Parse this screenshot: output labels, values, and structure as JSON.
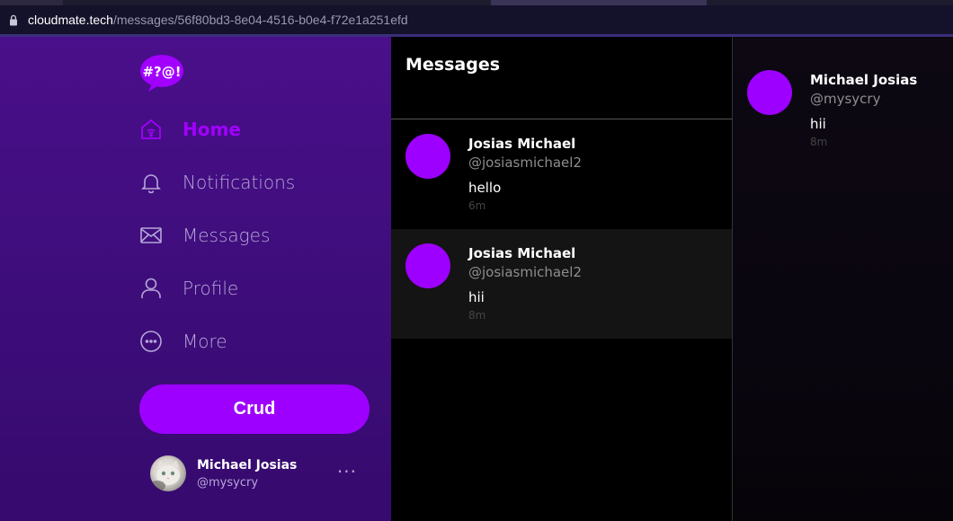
{
  "browser": {
    "url_domain": "cloudmate.tech",
    "url_path": "/messages/56f80bd3-8e04-4516-b0e4-f72e1a251efd"
  },
  "colors": {
    "accent": "#9d00ff",
    "sidebar_bg": "#3d0d7a"
  },
  "sidebar": {
    "logo_icon": "chat-bubble-logo-icon",
    "nav": [
      {
        "label": "Home",
        "icon": "home-icon",
        "active": true
      },
      {
        "label": "Notifications",
        "icon": "bell-icon",
        "active": false
      },
      {
        "label": "Messages",
        "icon": "envelope-icon",
        "active": false
      },
      {
        "label": "Profile",
        "icon": "user-icon",
        "active": false
      },
      {
        "label": "More",
        "icon": "more-circle-icon",
        "active": false
      }
    ],
    "action_button": "Crud",
    "user": {
      "name": "Michael Josias",
      "handle": "@mysycry",
      "more": "···"
    }
  },
  "messages": {
    "title": "Messages",
    "items": [
      {
        "name": "Josias Michael",
        "handle": "@josiasmichael2",
        "text": "hello",
        "time": "6m",
        "selected": false
      },
      {
        "name": "Josias Michael",
        "handle": "@josiasmichael2",
        "text": "hii",
        "time": "8m",
        "selected": true
      }
    ]
  },
  "detail": {
    "name": "Michael Josias",
    "handle": "@mysycry",
    "text": "hii",
    "time": "8m"
  }
}
